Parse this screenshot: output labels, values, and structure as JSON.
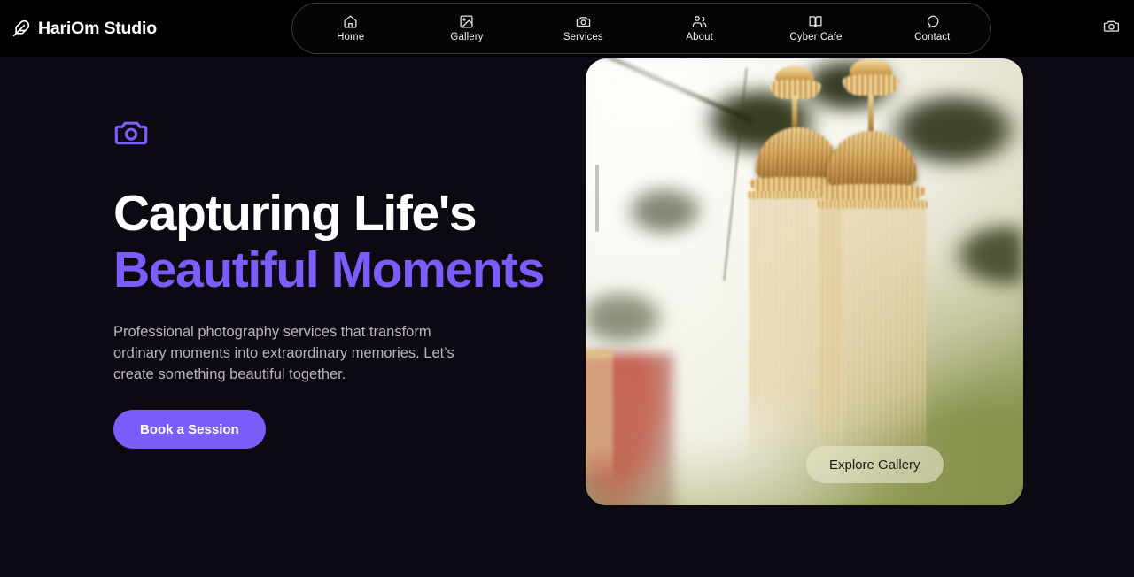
{
  "header": {
    "brand": {
      "name": "HariOm Studio",
      "icon": "feather-icon"
    },
    "nav": [
      {
        "label": "Home",
        "icon": "home-icon"
      },
      {
        "label": "Gallery",
        "icon": "image-icon"
      },
      {
        "label": "Services",
        "icon": "camera-icon"
      },
      {
        "label": "About",
        "icon": "users-icon"
      },
      {
        "label": "Cyber Cafe",
        "icon": "book-icon"
      },
      {
        "label": "Contact",
        "icon": "message-icon"
      }
    ],
    "action_icon": "camera-icon"
  },
  "hero": {
    "badge_icon": "camera-icon",
    "title_line1": "Capturing Life's",
    "title_line2": "Beautiful Moments",
    "description": "Professional photography services that transform ordinary moments into extraordinary memories. Let's create something beautiful together.",
    "primary_cta": "Book a Session",
    "image_cta": "Explore Gallery"
  },
  "colors": {
    "accent_purple": "#7c5cfa",
    "header_bg": "#000000",
    "page_bg": "#0d0913",
    "title_white": "#ffffff",
    "body_text": "#b9b3c2"
  }
}
